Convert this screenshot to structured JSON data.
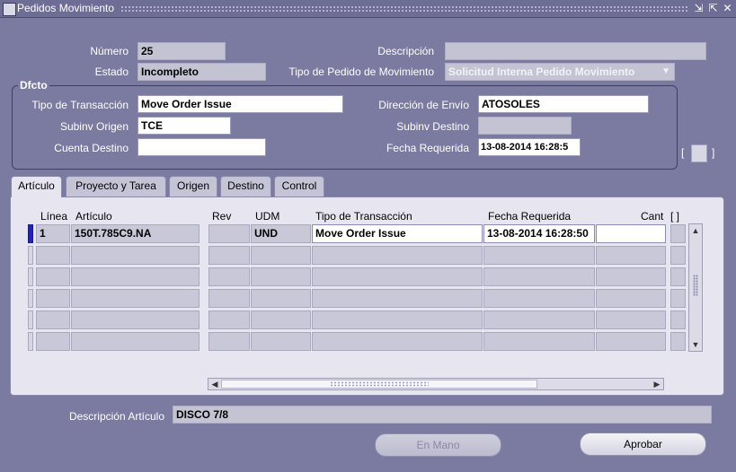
{
  "window": {
    "title": "Pedidos Movimiento"
  },
  "header": {
    "numero_label": "Número",
    "numero_value": "25",
    "descripcion_label": "Descripción",
    "descripcion_value": "",
    "estado_label": "Estado",
    "estado_value": "Incompleto",
    "tipo_pedido_label": "Tipo de Pedido de Movimiento",
    "tipo_pedido_value": "Solicitud Interna Pedido Movimiento"
  },
  "dfcto": {
    "group_title": "Dfcto",
    "tipo_transaccion_label": "Tipo de Transacción",
    "tipo_transaccion_value": "Move Order Issue",
    "direccion_envio_label": "Dirección de Envío",
    "direccion_envio_value": "ATOSOLES",
    "subinv_origen_label": "Subinv Origen",
    "subinv_origen_value": "TCE",
    "subinv_destino_label": "Subinv Destino",
    "subinv_destino_value": "",
    "cuenta_destino_label": "Cuenta Destino",
    "cuenta_destino_value": "",
    "fecha_requerida_label": "Fecha Requerida",
    "fecha_requerida_value": "13-08-2014 16:28:5"
  },
  "tabs": [
    "Artículo",
    "Proyecto y Tarea",
    "Origen",
    "Destino",
    "Control"
  ],
  "table": {
    "columns": [
      "Línea",
      "Artículo",
      "Rev",
      "UDM",
      "Tipo de Transacción",
      "Fecha Requerida",
      "Cant",
      "[ ]"
    ],
    "rows": [
      {
        "linea": "1",
        "articulo": "150T.785C9.NA",
        "rev": "",
        "udm": "UND",
        "tipo": "Move Order Issue",
        "fecha": "13-08-2014 16:28:50",
        "cant": ""
      }
    ]
  },
  "footer": {
    "descripcion_articulo_label": "Descripción Artículo",
    "descripcion_articulo_value": "DISCO 7/8",
    "en_mano_label": "En Mano",
    "aprobar_label": "Aprobar"
  }
}
